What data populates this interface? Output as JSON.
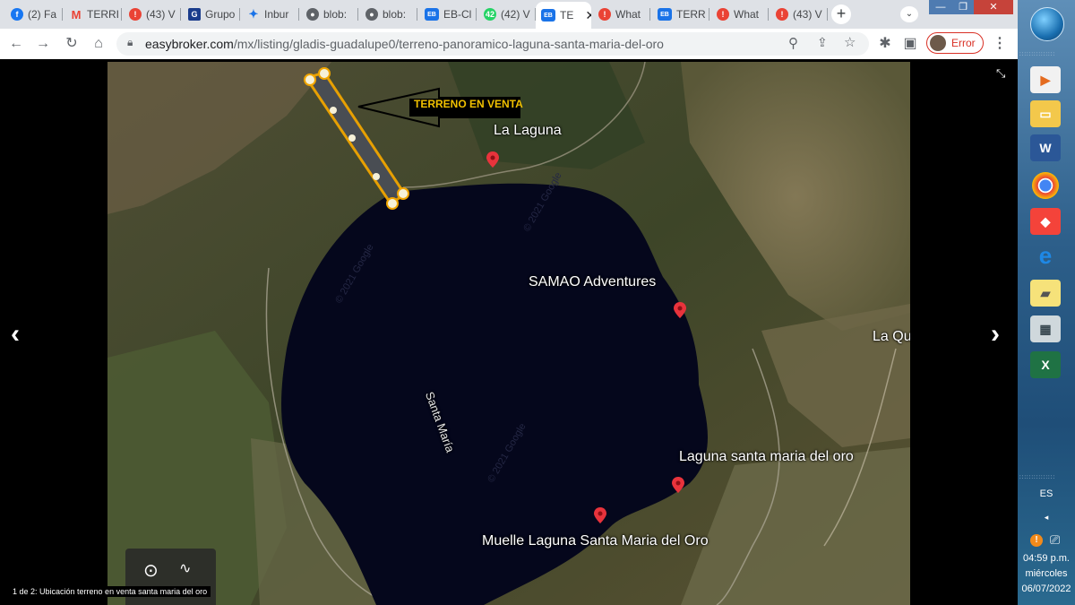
{
  "browser": {
    "tabs": [
      {
        "label": "(2) Fa",
        "icon": "facebook-icon"
      },
      {
        "label": "TERRI",
        "icon": "gmail-icon"
      },
      {
        "label": "(43) V",
        "icon": "alert-icon"
      },
      {
        "label": "Grupo",
        "icon": "grupo-icon"
      },
      {
        "label": "Inbur",
        "icon": "inbursa-icon"
      },
      {
        "label": "blob:",
        "icon": "github-icon"
      },
      {
        "label": "blob:",
        "icon": "github-icon"
      },
      {
        "label": "EB-Cl",
        "icon": "easybroker-icon"
      },
      {
        "label": "(42) V",
        "icon": "whatsapp-icon"
      },
      {
        "label": "TE",
        "icon": "easybroker-icon"
      },
      {
        "label": "What",
        "icon": "alert-icon"
      },
      {
        "label": "TERR",
        "icon": "easybroker-icon"
      },
      {
        "label": "What",
        "icon": "alert-icon"
      },
      {
        "label": "(43) V",
        "icon": "alert-icon"
      }
    ],
    "new_tab": "+",
    "url_host": "easybroker.com",
    "url_path": "/mx/listing/gladis-guadalupe0/terreno-panoramico-laguna-santa-maria-del-oro",
    "profile_label": "Error"
  },
  "map": {
    "callout": "TERRENO EN VENTA",
    "labels": {
      "la_laguna": "La Laguna",
      "samao": "SAMAO Adventures",
      "santa_maria": "Santa María",
      "laguna_santa_maria": "Laguna santa maria del oro",
      "muelle": "Muelle Laguna Santa Maria del Oro",
      "la_qu": "La Qu"
    },
    "watermark": "© 2021 Google"
  },
  "viewer": {
    "caption": "1 de 2: Ubicación terreno en venta santa maria del oro",
    "prev": "‹",
    "next": "›"
  },
  "taskbar": {
    "language": "ES",
    "time": "04:59 p.m.",
    "day": "miércoles",
    "date": "06/07/2022"
  },
  "colors": {
    "callout": "#f0a500",
    "pin": "#e8333c",
    "lake": "#05071c"
  }
}
